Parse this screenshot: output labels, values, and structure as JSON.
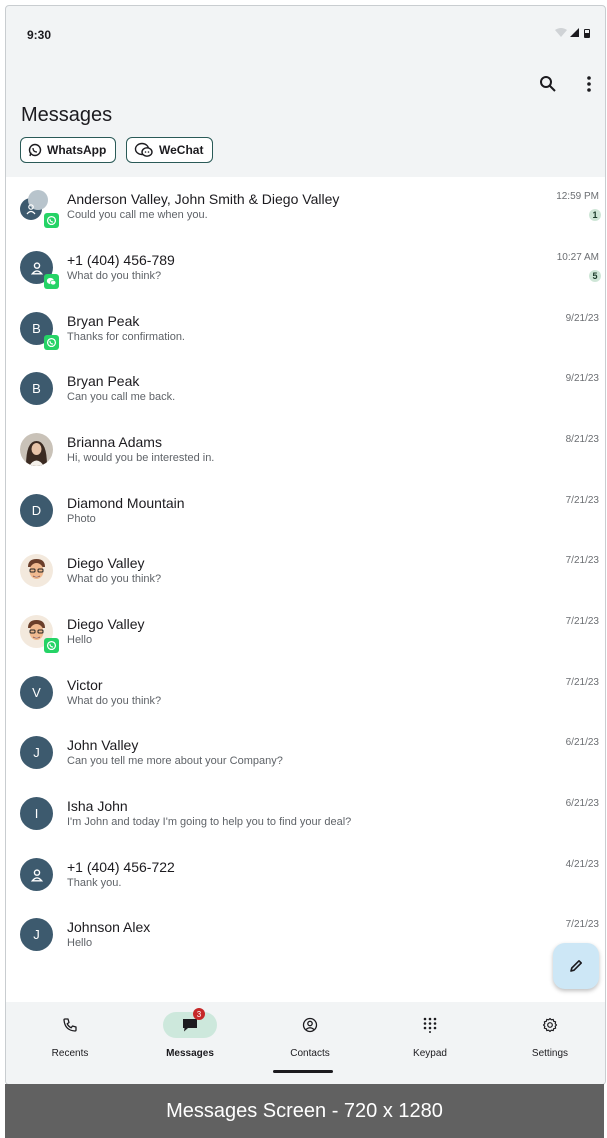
{
  "status_bar": {
    "time": "9:30"
  },
  "header": {
    "title": "Messages"
  },
  "filters": [
    {
      "label": "WhatsApp",
      "icon": "whatsapp-icon"
    },
    {
      "label": "WeChat",
      "icon": "wechat-icon"
    }
  ],
  "conversations": [
    {
      "name": "Anderson Valley, John Smith & Diego Valley",
      "preview": "Could you call me when you.",
      "date": "12:59 PM",
      "unread": "1",
      "avatar": "group-avatar",
      "channel": "whatsapp"
    },
    {
      "name": "+1 (404) 456-789",
      "preview": "What do you think?",
      "date": "10:27 AM",
      "unread": "5",
      "avatar": "person-icon",
      "channel": "wechat"
    },
    {
      "name": "Bryan Peak",
      "preview": "Thanks for confirmation.",
      "date": "9/21/23",
      "initial": "B",
      "channel": "whatsapp"
    },
    {
      "name": "Bryan Peak",
      "preview": "Can you call me back.",
      "date": "9/21/23",
      "initial": "B"
    },
    {
      "name": "Brianna Adams",
      "preview": "Hi, would you be interested in.",
      "date": "8/21/23",
      "avatar": "photo-woman"
    },
    {
      "name": "Diamond Mountain",
      "preview": "Photo",
      "date": "7/21/23",
      "initial": "D"
    },
    {
      "name": "Diego Valley",
      "preview": "What do you think?",
      "date": "7/21/23",
      "avatar": "photo-man"
    },
    {
      "name": "Diego Valley",
      "preview": "Hello",
      "date": "7/21/23",
      "avatar": "photo-man",
      "channel": "whatsapp"
    },
    {
      "name": "Victor",
      "preview": "What do you think?",
      "date": "7/21/23",
      "initial": "V"
    },
    {
      "name": "John Valley",
      "preview": "Can you tell me more about your Company?",
      "date": "6/21/23",
      "initial": "J"
    },
    {
      "name": "Isha John",
      "preview": "I'm John and today I'm going to help you to find your deal?",
      "date": "6/21/23",
      "initial": "I"
    },
    {
      "name": "+1 (404) 456-722",
      "preview": "Thank you.",
      "date": "4/21/23",
      "avatar": "person-icon"
    },
    {
      "name": "Johnson Alex",
      "preview": "Hello",
      "date": "7/21/23",
      "initial": "J"
    }
  ],
  "bottom_nav": {
    "items": [
      {
        "label": "Recents",
        "icon": "phone-icon"
      },
      {
        "label": "Messages",
        "icon": "chat-icon",
        "badge": "3",
        "active": true
      },
      {
        "label": "Contacts",
        "icon": "contact-icon"
      },
      {
        "label": "Keypad",
        "icon": "keypad-icon"
      },
      {
        "label": "Settings",
        "icon": "gear-icon"
      }
    ]
  },
  "caption": "Messages Screen - 720 x 1280",
  "colors": {
    "avatar": "#3d5a6e",
    "whatsapp": "#25d366",
    "active_nav": "#cde8dc",
    "fab": "#cde7f6",
    "badge": "#c62828"
  }
}
